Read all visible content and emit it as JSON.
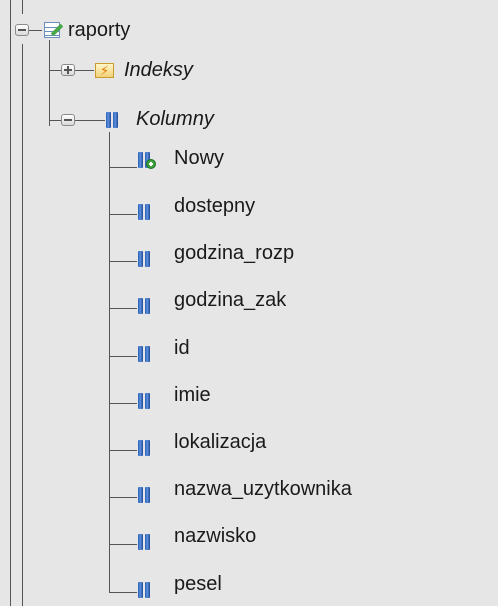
{
  "tree": {
    "table": {
      "name": "raporty",
      "icon": "table-edit-icon"
    },
    "indexes": {
      "label": "Indeksy",
      "icon": "index-icon"
    },
    "columns": {
      "label": "Kolumny",
      "icon": "columns-icon",
      "new_item": {
        "label": "Nowy",
        "icon": "new-column-icon"
      },
      "items": [
        {
          "label": "dostepny"
        },
        {
          "label": "godzina_rozp"
        },
        {
          "label": "godzina_zak"
        },
        {
          "label": "id"
        },
        {
          "label": "imie"
        },
        {
          "label": "lokalizacja"
        },
        {
          "label": "nazwa_uzytkownika"
        },
        {
          "label": "nazwisko"
        },
        {
          "label": "pesel"
        }
      ]
    }
  },
  "colors": {
    "background": "#e6e6e6",
    "connector": "#555555",
    "column_icon": "#2a5fb0"
  }
}
